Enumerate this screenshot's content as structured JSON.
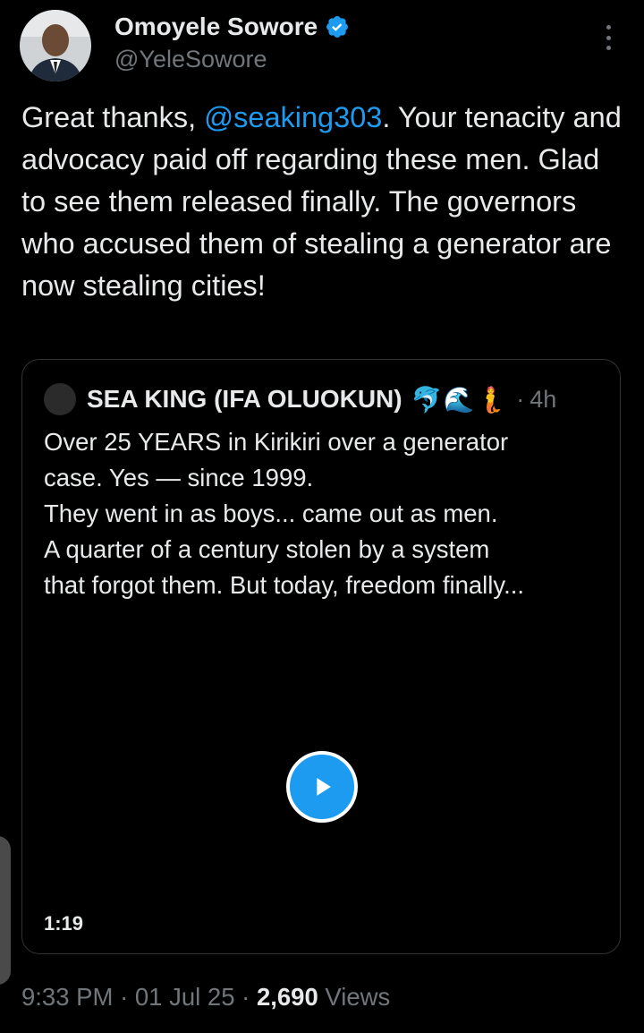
{
  "author": {
    "name": "Omoyele Sowore",
    "handle": "@YeleSowore",
    "verified": true,
    "verified_color": "#1d9bf0"
  },
  "tweet": {
    "text_before": "Great thanks, ",
    "mention": "@seaking303",
    "text_after": ". Your tenacity and advocacy paid off regarding these men. Glad to see them released finally. The governors who accused them of stealing a generator are now stealing cities!"
  },
  "quote": {
    "name": "SEA KING (IFA OLUOKUN)",
    "emoji": "🐬🌊🧜",
    "separator": "·",
    "time": "4h",
    "lines": [
      "Over 25 YEARS in Kirikiri over a generator",
      "case. Yes — since 1999.",
      "They went in as boys... came out as men.",
      "A quarter of a century stolen by a system",
      "that forgot them. But today, freedom finally..."
    ],
    "video_duration": "1:19"
  },
  "meta": {
    "time": "9:33 PM",
    "sep1": "·",
    "date": "01 Jul 25",
    "sep2": "·",
    "views_count": "2,690",
    "views_label": "Views"
  },
  "colors": {
    "background": "#000000",
    "text": "#e7e9ea",
    "muted": "#71767b",
    "accent": "#1d9bf0",
    "border": "#2f3336"
  },
  "icons": {
    "verified": "verified-badge-icon",
    "more": "more-vertical-icon",
    "play": "play-icon"
  }
}
